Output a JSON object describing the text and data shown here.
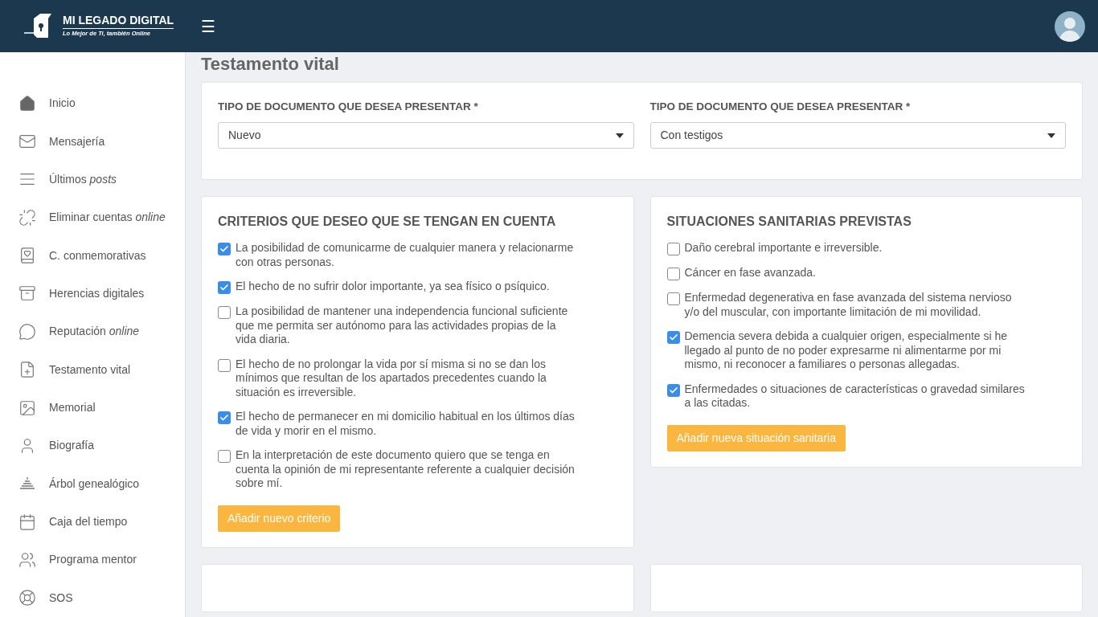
{
  "header": {
    "logo_title": "MI LEGADO DIGITAL",
    "logo_tagline": "Lo Mejor de Ti, también Online",
    "menu_glyph": "☰"
  },
  "sidebar": {
    "items": [
      {
        "kind": "home",
        "label": "Inicio"
      },
      {
        "kind": "mail",
        "label": "Mensajería"
      },
      {
        "kind": "lines",
        "label": "Últimos *posts*"
      },
      {
        "kind": "unlink",
        "label": "Eliminar cuentas *online*"
      },
      {
        "kind": "book",
        "label": "C. conmemorativas"
      },
      {
        "kind": "archive",
        "label": "Herencias digitales"
      },
      {
        "kind": "chat",
        "label": "Reputación *online*"
      },
      {
        "kind": "file",
        "label": "Testamento vital"
      },
      {
        "kind": "image",
        "label": "Memorial"
      },
      {
        "kind": "user",
        "label": "Biografía"
      },
      {
        "kind": "tree",
        "label": "Árbol genealógico"
      },
      {
        "kind": "calendar",
        "label": "Caja del tiempo"
      },
      {
        "kind": "users",
        "label": "Programa mentor"
      },
      {
        "kind": "lifebuoy",
        "label": "SOS"
      }
    ]
  },
  "page_title": "Testamento vital",
  "document_form": {
    "fields": [
      {
        "label": "TIPO DE DOCUMENTO QUE DESEA PRESENTAR *",
        "value": "Nuevo"
      },
      {
        "label": "TIPO DE DOCUMENTO QUE DESEA PRESENTAR *",
        "value": "Con testigos"
      }
    ]
  },
  "panels": [
    {
      "title": "CRITERIOS QUE DESEO QUE SE TENGAN EN CUENTA",
      "options": [
        {
          "label": "La posibilidad de comunicarme de cualquier manera y relacionarme con otras personas.",
          "checked": true
        },
        {
          "label": "El hecho de no sufrir dolor importante, ya sea físico o psíquico.",
          "checked": true
        },
        {
          "label": "La posibilidad de mantener una independencia funcional suficiente que me permita ser autónomo para las actividades propias de la vida diaria.",
          "checked": false
        },
        {
          "label": "El hecho de no prolongar la vida por sí misma si no se dan los mínimos que resultan de los apartados precedentes cuando la situación es irreversible.",
          "checked": false
        },
        {
          "label": "El hecho de permanecer en mi domicilio habitual en los últimos días de vida y morir en el mismo.",
          "checked": true
        },
        {
          "label": "En la interpretación de este documento quiero que se tenga en cuenta la opinión de mi representante referente a cualquier decisión sobre mí.",
          "checked": false
        }
      ],
      "button": "Añadir nuevo criterio"
    },
    {
      "title": "SITUACIONES SANITARIAS PREVISTAS",
      "options": [
        {
          "label": "Daño cerebral importante e irreversible.",
          "checked": false
        },
        {
          "label": "Cáncer en fase avanzada.",
          "checked": false
        },
        {
          "label": "Enfermedad degenerativa en fase avanzada del sistema nervioso y/o del muscular, con importante limitación de mi movilidad.",
          "checked": false
        },
        {
          "label": "Demencia severa debida a cualquier origen, especialmente si he llegado al punto de no poder expresarme ni alimentarme por mi mismo, ni reconocer a familiares o personas allegadas.",
          "checked": true
        },
        {
          "label": "Enfermedades o situaciones de características o gravedad similares a las citadas.",
          "checked": true
        }
      ],
      "button": "Añadir nueva situación sanitaria"
    }
  ]
}
